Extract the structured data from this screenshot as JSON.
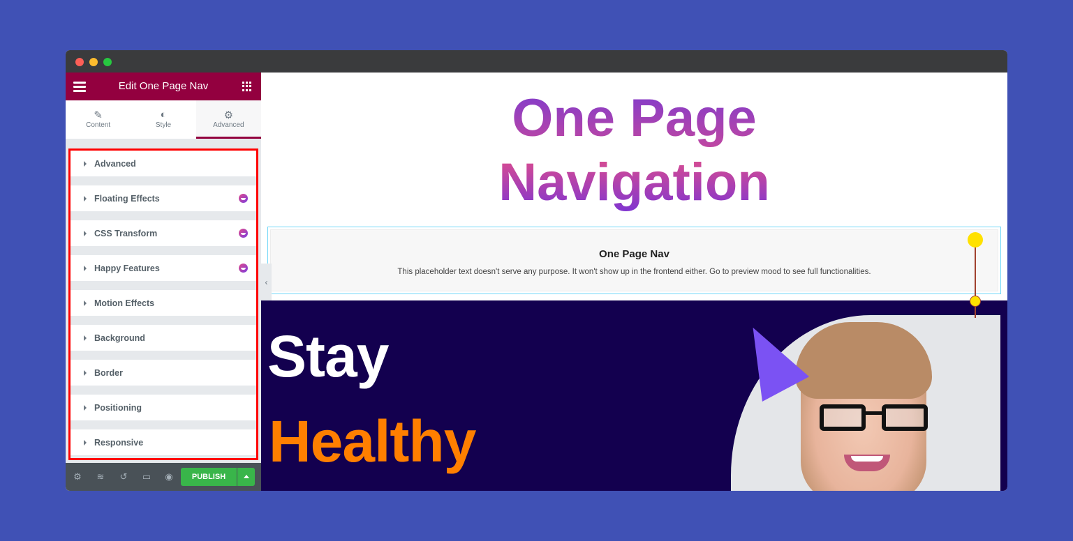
{
  "window": {
    "controls": [
      "close",
      "minimize",
      "maximize"
    ]
  },
  "sidebar": {
    "header": {
      "title": "Edit One Page Nav",
      "menu_icon": "hamburger-icon",
      "widgets_icon": "grid-icon"
    },
    "tabs": [
      {
        "label": "Content",
        "icon": "pencil-icon",
        "active": false
      },
      {
        "label": "Style",
        "icon": "contrast-icon",
        "active": false
      },
      {
        "label": "Advanced",
        "icon": "gear-icon",
        "active": true
      }
    ],
    "sections": [
      {
        "label": "Advanced",
        "badge": false
      },
      {
        "label": "Floating Effects",
        "badge": true
      },
      {
        "label": "CSS Transform",
        "badge": true
      },
      {
        "label": "Happy Features",
        "badge": true
      },
      {
        "label": "Motion Effects",
        "badge": false
      },
      {
        "label": "Background",
        "badge": false
      },
      {
        "label": "Border",
        "badge": false
      },
      {
        "label": "Positioning",
        "badge": false
      },
      {
        "label": "Responsive",
        "badge": false
      }
    ],
    "footer": {
      "icons": [
        "settings-icon",
        "navigator-icon",
        "history-icon",
        "responsive-mode-icon",
        "preview-icon"
      ],
      "publish_label": "PUBLISH"
    },
    "colors": {
      "header": "#93003f",
      "publish": "#39b54a",
      "highlight_border": "#ff0000"
    }
  },
  "canvas": {
    "hero": {
      "line1": "One Page",
      "line2": "Navigation"
    },
    "nav_widget": {
      "title": "One Page Nav",
      "text": "This placeholder text doesn't serve any purpose. It won't show up in the frontend either. Go to preview mood to see full functionalities."
    },
    "banner": {
      "word1": "Stay",
      "word2": "Healthy",
      "word1_color": "#ffffff",
      "word2_color": "#ff7f00",
      "background": "#13004f"
    },
    "collapse_label": "‹"
  }
}
